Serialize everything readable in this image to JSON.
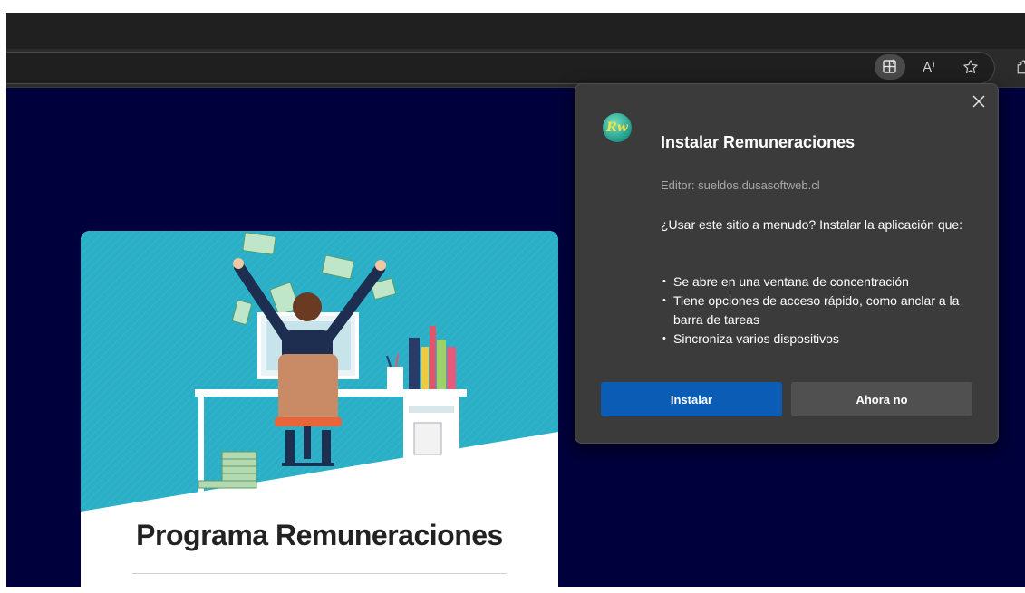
{
  "browser": {
    "toolbar_icons": [
      "app-available-icon",
      "read-aloud-icon",
      "favorite-star-icon",
      "extensions-icon"
    ],
    "read_aloud_glyph": "A⁾"
  },
  "page": {
    "background": "#00003c",
    "card": {
      "title": "Programa Remuneraciones",
      "illustration_background": "#2aafc6"
    }
  },
  "install_popup": {
    "logo_text": "Rw",
    "title": "Instalar Remuneraciones",
    "publisher": "Editor: sueldos.dusasoftweb.cl",
    "question": "¿Usar este sitio a menudo? Instalar la aplicación que:",
    "features": [
      "Se abre en una ventana de concentración",
      "Tiene opciones de acceso rápido, como anclar a la barra de tareas",
      "Sincroniza varios dispositivos"
    ],
    "install_label": "Instalar",
    "dismiss_label": "Ahora no",
    "colors": {
      "primary": "#0a5cb4",
      "secondary": "#505050",
      "panel": "#3b3b3b"
    }
  }
}
